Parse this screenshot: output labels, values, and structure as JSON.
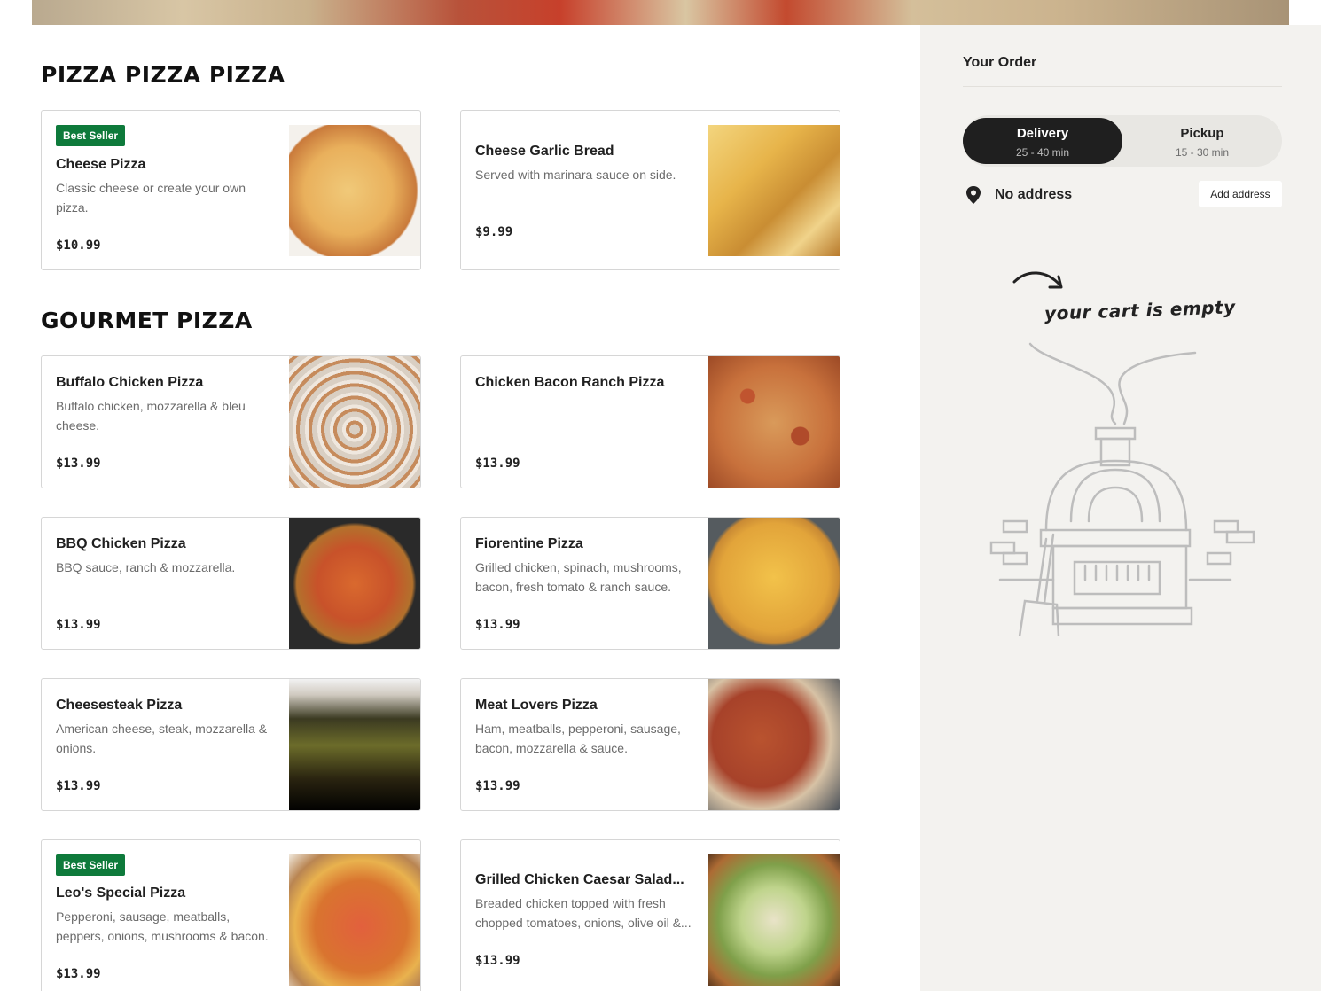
{
  "sections": [
    {
      "title": "PIZZA PIZZA PIZZA",
      "items": [
        {
          "name": "Cheese Pizza",
          "desc": "Classic cheese or create your own pizza.",
          "price": "$10.99",
          "badge": "Best Seller"
        },
        {
          "name": "Cheese Garlic Bread",
          "desc": "Served with marinara sauce on side.",
          "price": "$9.99"
        }
      ]
    },
    {
      "title": "GOURMET PIZZA",
      "items": [
        {
          "name": "Buffalo Chicken Pizza",
          "desc": "Buffalo chicken, mozzarella & bleu cheese.",
          "price": "$13.99"
        },
        {
          "name": "Chicken Bacon Ranch Pizza",
          "desc": "",
          "price": "$13.99"
        },
        {
          "name": "BBQ Chicken Pizza",
          "desc": "BBQ sauce, ranch & mozzarella.",
          "price": "$13.99"
        },
        {
          "name": "Fiorentine Pizza",
          "desc": "Grilled chicken, spinach, mushrooms, bacon, fresh tomato & ranch sauce.",
          "price": "$13.99"
        },
        {
          "name": "Cheesesteak Pizza",
          "desc": "American cheese, steak, mozzarella & onions.",
          "price": "$13.99"
        },
        {
          "name": "Meat Lovers Pizza",
          "desc": "Ham, meatballs, pepperoni, sausage, bacon, mozzarella & sauce.",
          "price": "$13.99"
        },
        {
          "name": "Leo's Special Pizza",
          "desc": "Pepperoni, sausage, meatballs, peppers, onions, mushrooms & bacon.",
          "price": "$13.99",
          "badge": "Best Seller"
        },
        {
          "name": "Grilled Chicken Caesar Salad...",
          "desc": "Breaded chicken topped with fresh chopped tomatoes, onions, olive oil &...",
          "price": "$13.99"
        }
      ]
    }
  ],
  "order": {
    "title": "Your Order",
    "delivery_label": "Delivery",
    "delivery_time": "25 - 40 min",
    "pickup_label": "Pickup",
    "pickup_time": "15 - 30 min",
    "address_text": "No address",
    "add_address_label": "Add address",
    "empty_cart_text": "your cart is empty"
  },
  "icons": [
    "location-pin-icon",
    "arrow-icon",
    "pizza-oven-illustration"
  ],
  "colors": {
    "badge": "#0e7a3b",
    "toggle_active": "#1f1f1f",
    "sidebar_bg": "#f3f2ef"
  }
}
